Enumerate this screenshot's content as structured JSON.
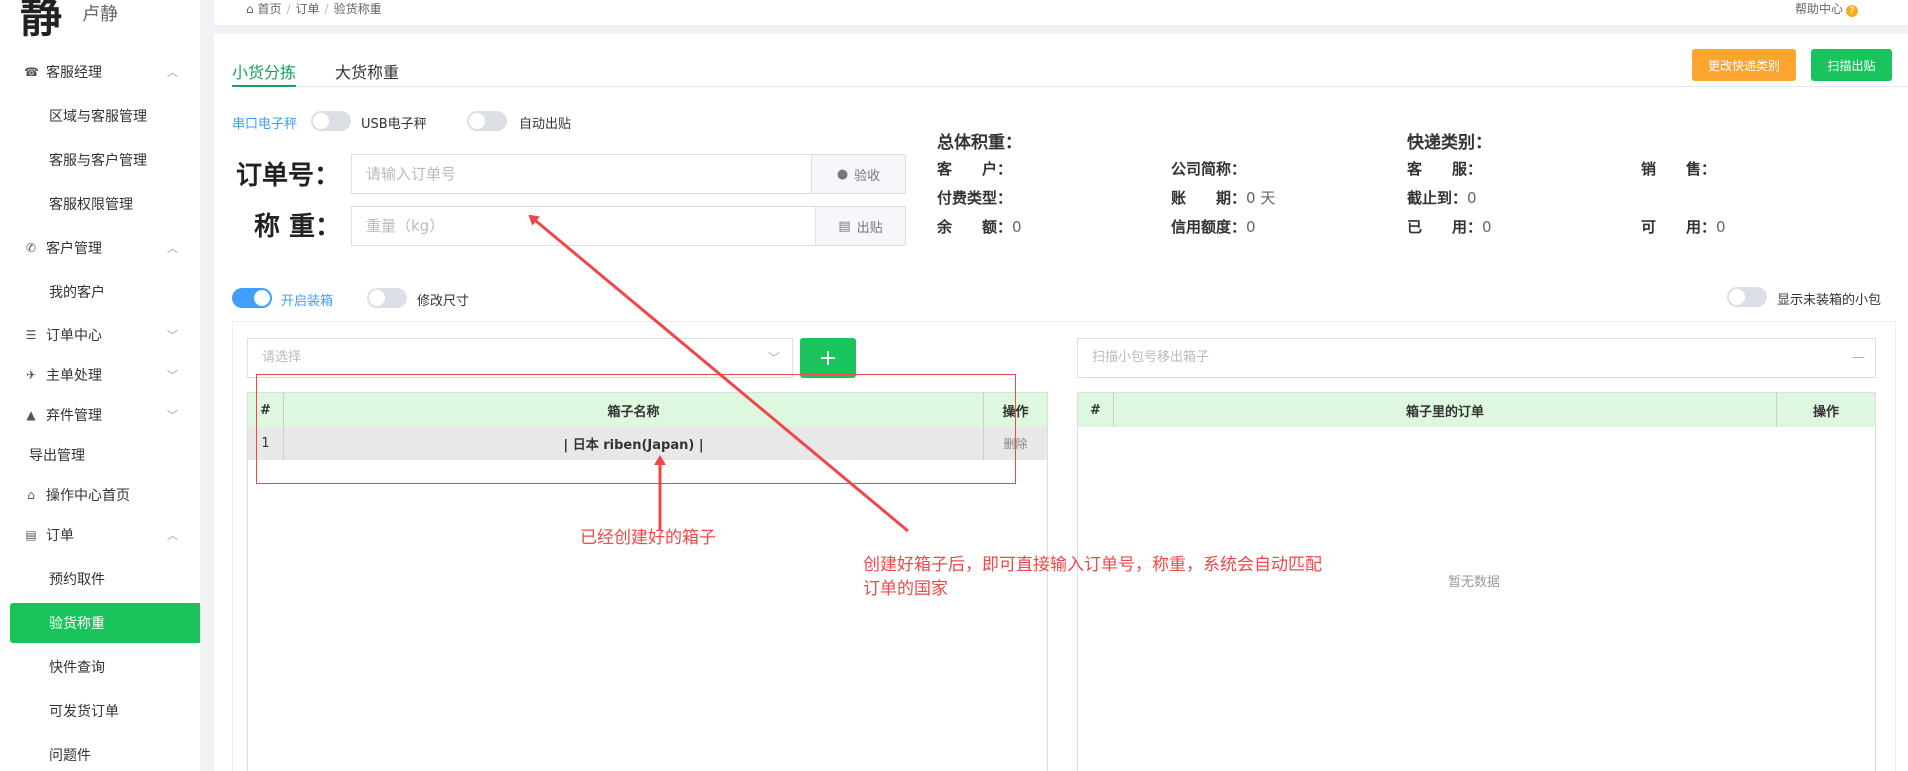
{
  "sidebar": {
    "logo_mark": "静",
    "logo_text": "卢静",
    "items": [
      {
        "label": "客服经理",
        "icon": "phone-icon",
        "chev": "^"
      },
      {
        "label": "区域与客服管理"
      },
      {
        "label": "客服与客户管理"
      },
      {
        "label": "客服权限管理"
      },
      {
        "label": "客户管理",
        "icon": "phone-book-icon",
        "chev": "^"
      },
      {
        "label": "我的客户"
      },
      {
        "label": "订单中心",
        "icon": "list-icon",
        "chev": "v"
      },
      {
        "label": "主单处理",
        "icon": "plane-icon",
        "chev": "v"
      },
      {
        "label": "弃件管理",
        "icon": "warning-icon",
        "chev": "v"
      },
      {
        "label": "导出管理"
      },
      {
        "label": "操作中心首页",
        "icon": "home-icon"
      },
      {
        "label": "订单",
        "icon": "file-icon",
        "chev": "^"
      },
      {
        "label": "预约取件"
      },
      {
        "label": "验货称重"
      },
      {
        "label": "快件查询"
      },
      {
        "label": "可发货订单"
      },
      {
        "label": "问题件"
      }
    ]
  },
  "breadcrumb": {
    "home": "首页",
    "sep": "/",
    "orders": "订单",
    "current": "验货称重"
  },
  "help": {
    "label": "帮助中心",
    "q": "?"
  },
  "tabs": {
    "small": "小货分拣",
    "big": "大货称重"
  },
  "buttons": {
    "change_express": "更改快递类别",
    "scan_out": "扫描出贴"
  },
  "toggles": {
    "serial_scale": "串口电子秤",
    "usb_scale": "USB电子秤",
    "auto_label": "自动出贴",
    "enable_box": "开启装箱",
    "edit_size": "修改尺寸",
    "show_unboxed": "显示未装箱的小包"
  },
  "order": {
    "label": "订单号：",
    "placeholder": "请输入订单号",
    "verify": "验收"
  },
  "weight": {
    "label": "称 重：",
    "placeholder": "重量（kg）",
    "print": "出贴"
  },
  "info": {
    "total_volume": "总体积重：",
    "express_type": "快递类别：",
    "customer": "客　　户：",
    "company": "公司简称：",
    "service": "客　　服：",
    "sales": "销　　售：",
    "pay_type": "付费类型：",
    "period": "账　　期：",
    "period_val": "0 天",
    "cutoff": "截止到：",
    "cutoff_val": "0",
    "balance": "余　　额：",
    "balance_val": "0",
    "credit": "信用额度：",
    "credit_val": "0",
    "used": "已　　用：",
    "used_val": "0",
    "available": "可　　用：",
    "available_val": "0"
  },
  "box_select": {
    "placeholder": "请选择",
    "add": "+"
  },
  "scan_input": {
    "placeholder": "扫描小包号移出箱子",
    "dash": "—"
  },
  "box_table": {
    "headers": [
      "#",
      "箱子名称",
      "操作"
    ],
    "rows": [
      {
        "num": "1",
        "name": "| 日本 riben(Japan) |",
        "action": "删除"
      }
    ]
  },
  "order_table": {
    "headers": [
      "#",
      "箱子里的订单",
      "操作"
    ],
    "empty": "暂无数据"
  },
  "annotations": {
    "created_box": "已经创建好的箱子",
    "instruction_line1": "创建好箱子后，即可直接输入订单号，称重，系统会自动匹配",
    "instruction_line2": "订单的国家"
  },
  "colors": {
    "accent": "#19a15f",
    "green": "#19c45d",
    "orange": "#fba430",
    "blue": "#409eff",
    "red": "#f04848"
  }
}
